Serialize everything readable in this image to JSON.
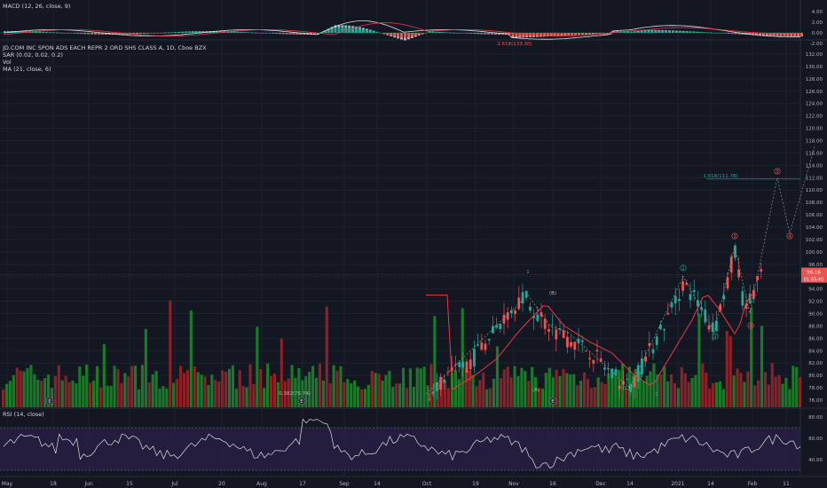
{
  "macd_legend": "MACD (12, 26, close, 9)",
  "main_legend": [
    "JD.COM INC SPON ADS EACH REPR 2 ORD SHS CLASS A, 1D, Cboe BZX",
    "SAR (0.02, 0.02, 0.2)",
    "Vol",
    "MA (21, close, 6)"
  ],
  "rsi_legend": "RSI (14, close)",
  "colors": {
    "bg": "#131722",
    "grid": "#1e222d",
    "up": "#26a69a",
    "down": "#ef5350",
    "vol_up": "#1b7a2a",
    "vol_down": "#8b2227",
    "rsi": "#7e57c2",
    "ma": "#f23645"
  },
  "price_axis": [
    "132.00",
    "130.00",
    "128.00",
    "126.00",
    "124.00",
    "122.00",
    "120.00",
    "118.00",
    "116.00",
    "114.00",
    "112.00",
    "110.00",
    "108.00",
    "106.00",
    "104.00",
    "102.00",
    "100.00",
    "98.00",
    "96.00",
    "94.00",
    "92.00",
    "90.00",
    "88.00",
    "86.00",
    "84.00",
    "82.00",
    "80.00",
    "78.00",
    "76.00"
  ],
  "macd_axis": [
    "4.00",
    "2.00",
    "0.00",
    "-2.00"
  ],
  "rsi_axis": [
    "80.00",
    "60.00",
    "40.00"
  ],
  "time_axis": [
    "May",
    "18",
    "Jun",
    "15",
    "Jul",
    "20",
    "Aug",
    "17",
    "Sep",
    "14",
    "Oct",
    "19",
    "Nov",
    "16",
    "Dec",
    "14",
    "2021",
    "14",
    "Feb",
    "11"
  ],
  "price_label": "96.16",
  "price_label2": "01:55:40",
  "fib_macd_label": "2.618(133.30)",
  "fib_upper_label": "1.618(111.78)",
  "fib_lower_label": "0.382(76.74)",
  "wave_labels": [
    "1",
    "(B)",
    "(A)",
    "(C)",
    "2",
    "1",
    "2",
    "3",
    "4",
    "3",
    "4"
  ],
  "earnings_marker": "E",
  "chart_data": {
    "type": "candlestick",
    "symbol": "JD.COM INC SPON ADS EACH REPR 2 ORD SHS CLASS A",
    "interval": "1D",
    "exchange": "Cboe BZX",
    "last_price": 96.16,
    "ylim": [
      75,
      133
    ],
    "approx_close_path": [
      {
        "x": "Oct",
        "y": 77
      },
      {
        "x": "19",
        "y": 83
      },
      {
        "x": "Nov",
        "y": 93
      },
      {
        "x": "16",
        "y": 88
      },
      {
        "x": "Dec",
        "y": 82
      },
      {
        "x": "14",
        "y": 79
      },
      {
        "x": "2021",
        "y": 96
      },
      {
        "x": "14",
        "y": 85
      },
      {
        "x": "Feb",
        "y": 96
      }
    ],
    "projection": [
      102,
      112,
      103,
      117
    ],
    "indicators": [
      "MACD (12, 26, close, 9)",
      "SAR (0.02, 0.02, 0.2)",
      "Vol",
      "MA (21, close, 6)",
      "RSI (14, close)"
    ]
  }
}
